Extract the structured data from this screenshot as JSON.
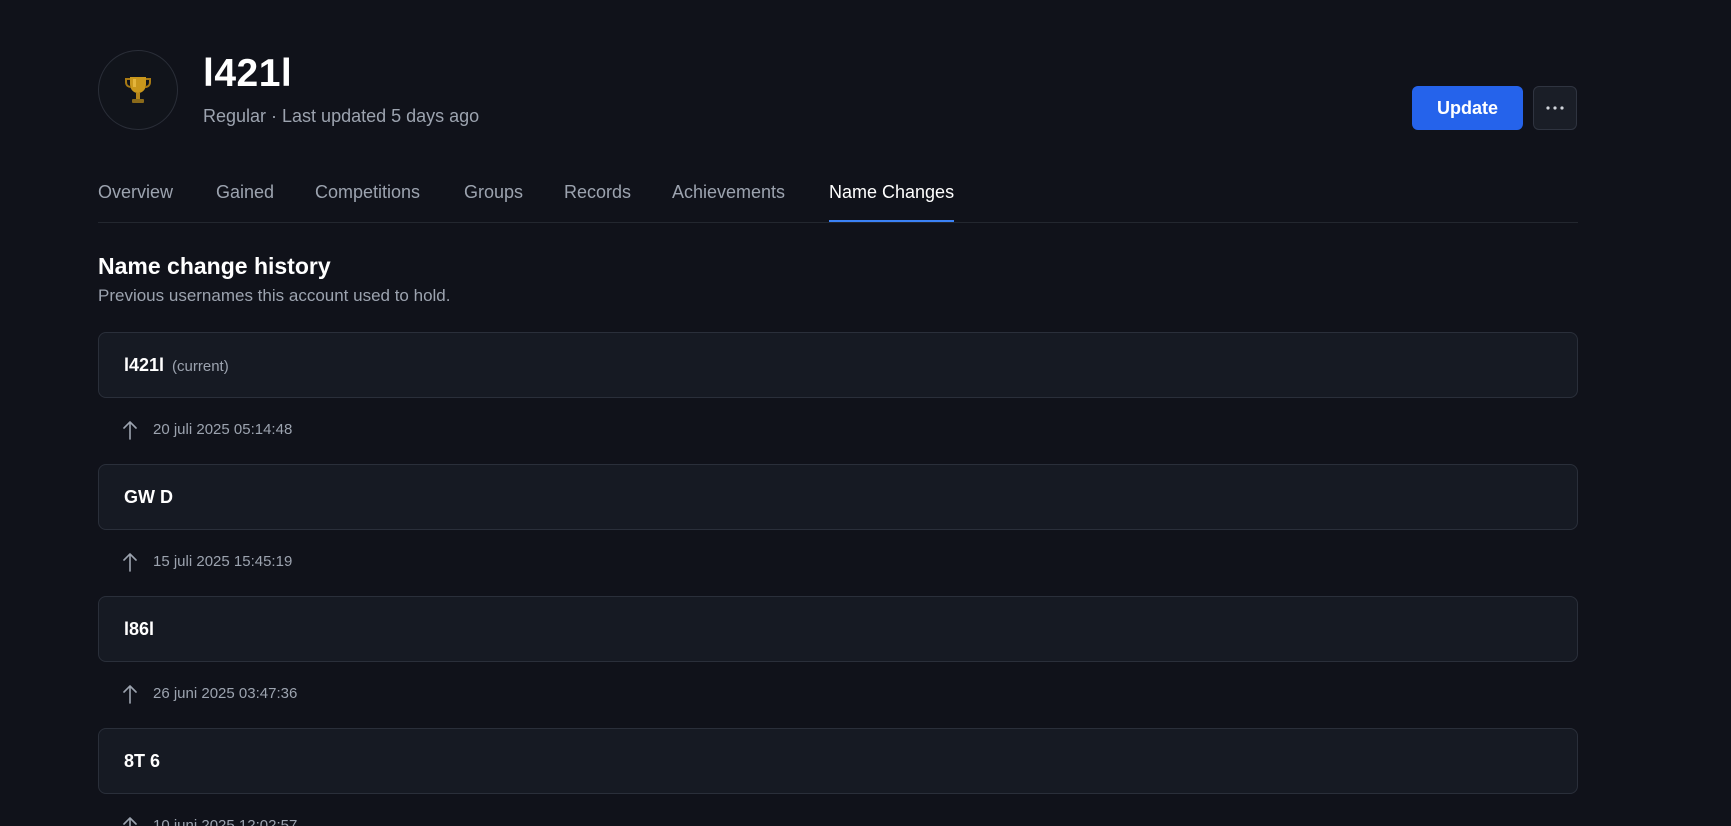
{
  "player": {
    "name": "l421l",
    "meta": "Regular · Last updated 5 days ago"
  },
  "actions": {
    "update_label": "Update",
    "more_icon": "ellipsis-icon"
  },
  "tabs": [
    {
      "label": "Overview"
    },
    {
      "label": "Gained"
    },
    {
      "label": "Competitions"
    },
    {
      "label": "Groups"
    },
    {
      "label": "Records"
    },
    {
      "label": "Achievements"
    },
    {
      "label": "Name Changes",
      "active": true
    }
  ],
  "section": {
    "title": "Name change history",
    "subtitle": "Previous usernames this account used to hold."
  },
  "history": {
    "names": [
      "l421l",
      "GW D",
      "l86l",
      "8T 6"
    ],
    "current_tag": "(current)",
    "dates": [
      "20 juli 2025 05:14:48",
      "15 juli 2025 15:45:19",
      "26 juni 2025 03:47:36",
      "10 juni 2025 12:02:57"
    ]
  },
  "colors": {
    "background": "#10121a",
    "accent": "#2563eb",
    "muted_text": "#9ca3af"
  }
}
